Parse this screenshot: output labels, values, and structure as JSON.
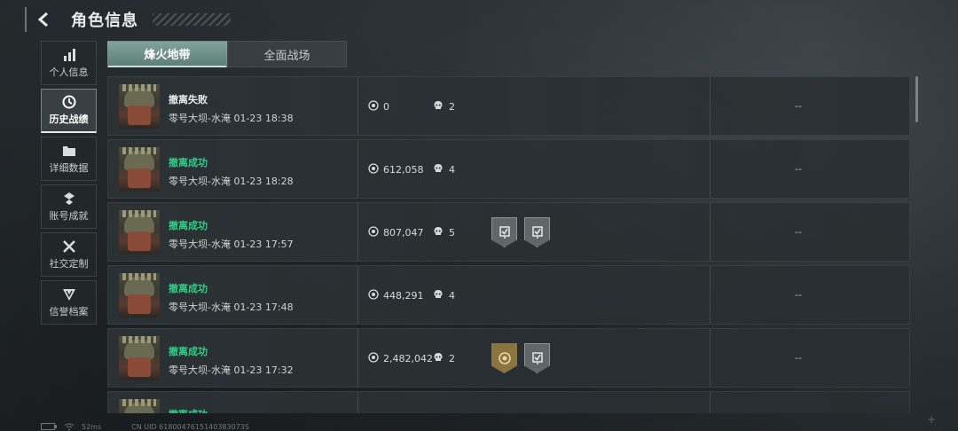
{
  "header": {
    "title": "角色信息"
  },
  "sidebar": {
    "items": [
      {
        "label": "个人信息",
        "icon": "bar-chart-icon",
        "active": false
      },
      {
        "label": "历史战绩",
        "icon": "clock-icon",
        "active": true
      },
      {
        "label": "详细数据",
        "icon": "folder-icon",
        "active": false
      },
      {
        "label": "账号成就",
        "icon": "achievement-icon",
        "active": false
      },
      {
        "label": "社交定制",
        "icon": "tools-icon",
        "active": false
      },
      {
        "label": "信誉档案",
        "icon": "shield-icon",
        "active": false
      }
    ]
  },
  "tabs": [
    {
      "label": "烽火地带",
      "active": true
    },
    {
      "label": "全面战场",
      "active": false
    }
  ],
  "records": [
    {
      "status": "撤离失败",
      "result": "fail",
      "map": "零号大坝-水淹 01-23 18:38",
      "value": "0",
      "kills": "2",
      "badges": [],
      "extra": "--"
    },
    {
      "status": "撤离成功",
      "result": "ok",
      "map": "零号大坝-水淹 01-23 18:28",
      "value": "612,058",
      "kills": "4",
      "badges": [],
      "extra": "--"
    },
    {
      "status": "撤离成功",
      "result": "ok",
      "map": "零号大坝-水淹 01-23 17:57",
      "value": "807,047",
      "kills": "5",
      "badges": [
        "grey",
        "grey"
      ],
      "extra": "--"
    },
    {
      "status": "撤离成功",
      "result": "ok",
      "map": "零号大坝-水淹 01-23 17:48",
      "value": "448,291",
      "kills": "4",
      "badges": [],
      "extra": "--"
    },
    {
      "status": "撤离成功",
      "result": "ok",
      "map": "零号大坝-水淹 01-23 17:32",
      "value": "2,482,042",
      "kills": "2",
      "badges": [
        "gold",
        "grey"
      ],
      "extra": "--"
    },
    {
      "status": "撤离成功",
      "result": "ok",
      "map": "",
      "value": "",
      "kills": "",
      "badges": [],
      "extra": ""
    }
  ],
  "footer": {
    "ping": "52ms",
    "uid": "CN UID 6180047615140383073S"
  },
  "colors": {
    "success": "#2fd08a",
    "tab_active": "#6f938a"
  }
}
